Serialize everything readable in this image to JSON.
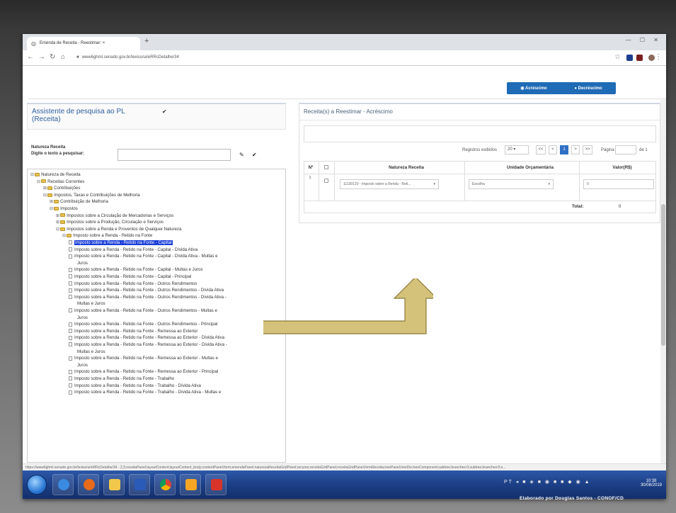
{
  "browser": {
    "tab_title": "Emenda de Receita - Reestimar: ×",
    "new_tab": "+",
    "url": "www6ghml.senado.gov.br/lexiss/ui/eRRcDetalhe/34"
  },
  "toggle": {
    "increase_label": "◉ Acréscimo",
    "decrease_label": "● Decréscimo"
  },
  "left": {
    "title": "Assistente de pesquisa ao PL (Receita)",
    "nature_label": "Natureza Receita",
    "search_label": "Digite o texto a pesquisar:",
    "search_value": "",
    "tree": [
      {
        "label": "Natureza de Receita",
        "level": 0,
        "type": "folder",
        "exp": "⊟"
      },
      {
        "label": "Receitas Correntes",
        "level": 1,
        "type": "folder",
        "exp": "⊟"
      },
      {
        "label": "Contribuições",
        "level": 2,
        "type": "folder",
        "exp": "⊞"
      },
      {
        "label": "Impostos, Taxas e Contribuições de Melhoria",
        "level": 2,
        "type": "folder",
        "exp": "⊟"
      },
      {
        "label": "Contribuição de Melhoria",
        "level": 3,
        "type": "folder",
        "exp": "⊞"
      },
      {
        "label": "Impostos",
        "level": 3,
        "type": "folder",
        "exp": "⊟"
      },
      {
        "label": "Impostos sobre a Circulação de Mercadorias e Serviços",
        "level": 4,
        "type": "folder",
        "exp": "⊞"
      },
      {
        "label": "Impostos sobre a Produção, Circulação e Serviços",
        "level": 4,
        "type": "folder",
        "exp": "⊞"
      },
      {
        "label": "Impostos sobre a Renda e Proventos de Qualquer Natureza",
        "level": 4,
        "type": "folder",
        "exp": "⊟"
      },
      {
        "label": "Imposto sobre a Renda - Retido na Fonte",
        "level": 5,
        "type": "folder",
        "exp": "⊟"
      },
      {
        "label": "Imposto sobre a Renda - Retido na Fonte - Capital",
        "level": 6,
        "type": "doc",
        "selected": true
      },
      {
        "label": "Imposto sobre a Renda - Retido na Fonte - Capital - Dívida Ativa",
        "level": 6,
        "type": "doc"
      },
      {
        "label": "Imposto sobre a Renda - Retido na Fonte - Capital - Dívida Ativa - Multas e",
        "level": 6,
        "type": "doc"
      },
      {
        "label": "Juros",
        "level": 6,
        "type": "cont"
      },
      {
        "label": "Imposto sobre a Renda - Retido na Fonte - Capital - Multas e Juros",
        "level": 6,
        "type": "doc"
      },
      {
        "label": "Imposto sobre a Renda - Retido na Fonte - Capital - Principal",
        "level": 6,
        "type": "doc"
      },
      {
        "label": "Imposto sobre a Renda - Retido na Fonte - Outros Rendimentos",
        "level": 6,
        "type": "doc"
      },
      {
        "label": "Imposto sobre a Renda - Retido na Fonte - Outros Rendimentos - Dívida Ativa",
        "level": 6,
        "type": "doc"
      },
      {
        "label": "Imposto sobre a Renda - Retido na Fonte - Outros Rendimentos - Dívida Ativa -",
        "level": 6,
        "type": "doc"
      },
      {
        "label": "Multas e Juros",
        "level": 6,
        "type": "cont"
      },
      {
        "label": "Imposto sobre a Renda - Retido na Fonte - Outros Rendimentos - Multas e",
        "level": 6,
        "type": "doc"
      },
      {
        "label": "Juros",
        "level": 6,
        "type": "cont"
      },
      {
        "label": "Imposto sobre a Renda - Retido na Fonte - Outros Rendimentos - Principal",
        "level": 6,
        "type": "doc"
      },
      {
        "label": "Imposto sobre a Renda - Retido na Fonte - Remessa ao Exterior",
        "level": 6,
        "type": "doc"
      },
      {
        "label": "Imposto sobre a Renda - Retido na Fonte - Remessa ao Exterior - Dívida Ativa",
        "level": 6,
        "type": "doc"
      },
      {
        "label": "Imposto sobre a Renda - Retido na Fonte - Remessa ao Exterior - Dívida Ativa -",
        "level": 6,
        "type": "doc"
      },
      {
        "label": "Multas e Juros",
        "level": 6,
        "type": "cont"
      },
      {
        "label": "Imposto sobre a Renda - Retido na Fonte - Remessa ao Exterior - Multas e",
        "level": 6,
        "type": "doc"
      },
      {
        "label": "Juros",
        "level": 6,
        "type": "cont"
      },
      {
        "label": "Imposto sobre a Renda - Retido na Fonte - Remessa ao Exterior - Principal",
        "level": 6,
        "type": "doc"
      },
      {
        "label": "Imposto sobre a Renda - Retido na Fonte - Trabalho",
        "level": 6,
        "type": "doc"
      },
      {
        "label": "Imposto sobre a Renda - Retido na Fonte - Trabalho - Dívida Ativa",
        "level": 6,
        "type": "doc"
      },
      {
        "label": "Imposto sobre a Renda - Retido na Fonte - Trabalho - Dívida Ativa - Multas e",
        "level": 6,
        "type": "doc"
      }
    ]
  },
  "right": {
    "title": "Receita(s) a Reestimar - Acréscimo",
    "records_label": "Registros exibidos",
    "records_value": "20",
    "pages": [
      "<<",
      "<",
      "1",
      ">",
      ">>"
    ],
    "page_label": "Página",
    "page_suffix": "de 1",
    "columns": [
      "Nº",
      "",
      "Natureza Receita",
      "Unidade Orçamentária",
      "Valor(R$)"
    ],
    "row": {
      "num": "1",
      "nature": "11130120 - Imposto sobre a Renda - Reti...",
      "unit": "Escolha",
      "value": "0"
    },
    "total_label": "Total:",
    "total_value": "0"
  },
  "status_text": "https://www6ghml.senado.gov.br/lexiss/ui/eRRcDetalhe/34 - 2;3;receitaPanel;layoutContent;layoutContent_body;contentPanel;form;emendaPanel;naturezaReceitaGridPanel;recurso;receitaGridPanel;receitaGridPanel;formReceita;treePanel;treeDiv;treeComponent;subtree;branches:0;subtree;branches:0;s...",
  "taskbar": {
    "tray_time": "10:38",
    "tray_date": "30/08/2019",
    "tray_lang": "PT"
  },
  "credit": "Elaborado por Douglas   Santos - CONOF/CD",
  "colors": {
    "accent": "#1f6bb5",
    "selection": "#1a3fd8",
    "arrow": "#d4c27a"
  }
}
